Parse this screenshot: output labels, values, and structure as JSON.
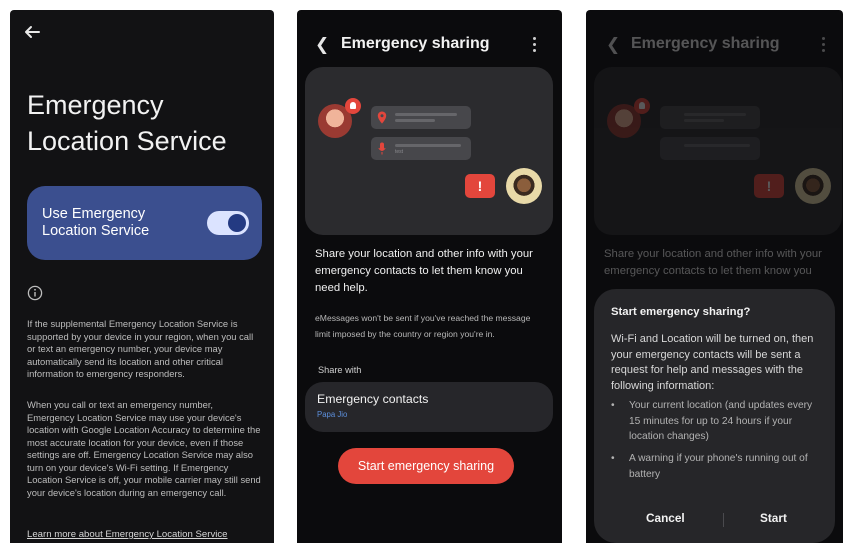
{
  "screen1": {
    "title": "Emergency Location Service",
    "toggle_label": "Use Emergency Location Service",
    "toggle_on": true,
    "paragraph1": "If the supplemental Emergency Location Service is supported by your device in your region, when you call or text an emergency number, your device may automatically send its location and other critical information to emergency responders.",
    "paragraph2": "When you call or text an emergency number, Emergency Location Service may use your device's location with Google Location Accuracy to determine the most accurate location for your device, even if those settings are off. Emergency Location Service may also turn on your device's Wi-Fi setting. If Emergency Location Service is off, your mobile carrier may still send your device's location during an emergency call.",
    "learn_more": "Learn more about Emergency Location Service"
  },
  "screen2": {
    "title": "Emergency sharing",
    "illustration_text": "test",
    "description": "Share your location and other info with your emergency contacts to let them know you need help.",
    "note": "eMessages won't be sent if you've reached the message limit imposed by the country or region you're in.",
    "share_with_label": "Share with",
    "contacts_title": "Emergency contacts",
    "contacts_name": "Papa Jio",
    "start_button": "Start emergency sharing"
  },
  "screen3": {
    "bg_title": "Emergency sharing",
    "bg_description": "Share your location and other info with your emergency contacts to let them know you need help.",
    "dialog": {
      "title": "Start emergency sharing?",
      "body": "Wi-Fi and Location will be turned on, then your emergency contacts will be sent a request for help and messages with the following information:",
      "bullets": [
        "Your current location (and updates every 15 minutes for up to 24 hours if your location changes)",
        "A warning if your phone's running out of battery"
      ],
      "cancel": "Cancel",
      "start": "Start"
    }
  },
  "colors": {
    "accent_red": "#e3463c",
    "toggle_card": "#3b4f8f",
    "link_blue": "#5c8fdc"
  }
}
